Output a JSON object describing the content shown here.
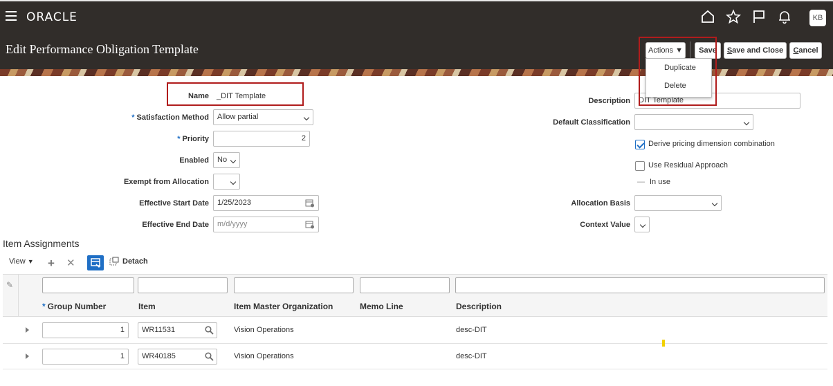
{
  "header": {
    "brand": "ORACLE",
    "user_initials": "KB",
    "icons": [
      "home-icon",
      "star-icon",
      "flag-icon",
      "bell-icon"
    ]
  },
  "page": {
    "title": "Edit Performance Obligation Template"
  },
  "toolbar": {
    "actions_label": "Actions",
    "save_label": "Save",
    "save_close_first": "S",
    "save_close_rest": "ave and Close",
    "cancel_first": "C",
    "cancel_rest": "ancel"
  },
  "actions_menu": {
    "items": [
      "Duplicate",
      "Delete"
    ]
  },
  "form": {
    "name": {
      "label": "Name",
      "value": "_DIT Template"
    },
    "satisfaction_method": {
      "label": "Satisfaction Method",
      "value": "Allow partial"
    },
    "priority": {
      "label": "Priority",
      "value": "2"
    },
    "enabled": {
      "label": "Enabled",
      "value": "No"
    },
    "exempt": {
      "label": "Exempt from Allocation",
      "value": ""
    },
    "start_date": {
      "label": "Effective Start Date",
      "value": "1/25/2023"
    },
    "end_date": {
      "label": "Effective End Date",
      "placeholder": "m/d/yyyy"
    },
    "description": {
      "label": "Description",
      "value": "DIT Template"
    },
    "default_classification": {
      "label": "Default Classification",
      "value": ""
    },
    "derive_pricing": {
      "label": "Derive pricing dimension combination",
      "checked": true
    },
    "use_residual": {
      "label": "Use Residual Approach",
      "checked": false
    },
    "in_use": {
      "label": "In use",
      "dash": "—"
    },
    "allocation_basis": {
      "label": "Allocation Basis",
      "value": ""
    },
    "context_value": {
      "label": "Context Value",
      "value": ""
    }
  },
  "items_section": {
    "title": "Item Assignments",
    "view_label": "View",
    "detach_label": "Detach",
    "columns": [
      "Group Number",
      "Item",
      "Item Master Organization",
      "Memo Line",
      "Description"
    ],
    "rows": [
      {
        "group_number": "1",
        "item": "WR11531",
        "org": "Vision Operations",
        "memo_line": "",
        "description": "desc-DIT"
      },
      {
        "group_number": "1",
        "item": "WR40185",
        "org": "Vision Operations",
        "memo_line": "",
        "description": "desc-DIT"
      }
    ]
  },
  "colors": {
    "header_bg": "#312d2a",
    "accent": "#1f6fc5",
    "highlight_box": "#b01c1c"
  }
}
